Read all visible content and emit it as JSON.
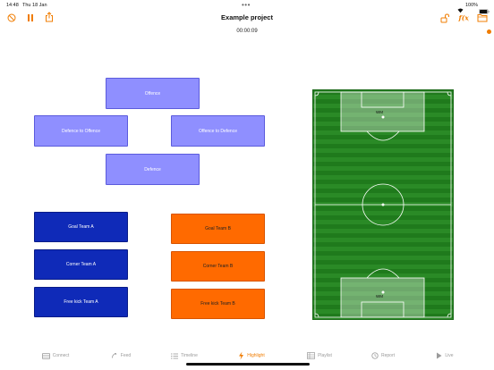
{
  "status_bar": {
    "time": "14:48",
    "date": "Thu 18 Jan",
    "battery": "100%",
    "dots": "•••"
  },
  "toolbar": {
    "title": "Example project",
    "timer": "00:00:09",
    "accent_color": "#f07c00",
    "left_icons": [
      "cancel-icon",
      "pause-icon",
      "share-icon"
    ],
    "right_icons": [
      "unlock-icon",
      "formula-icon",
      "folder-icon"
    ]
  },
  "tags": {
    "purple": [
      {
        "label": "Offence"
      },
      {
        "label": "Defence to Offence"
      },
      {
        "label": "Offence to Defence"
      },
      {
        "label": "Defence"
      }
    ],
    "team_a": [
      {
        "label": "Goal Team A"
      },
      {
        "label": "Corner Team A"
      },
      {
        "label": "Free kick Team A"
      }
    ],
    "team_b": [
      {
        "label": "Goal Team B"
      },
      {
        "label": "Corner Team B"
      },
      {
        "label": "Free kick Team B"
      }
    ],
    "colors": {
      "purple": "#8f8fff",
      "team_a": "#0f2ab8",
      "team_b": "#ff6a00"
    }
  },
  "field": {
    "top_label": "WM",
    "bottom_label": "WM",
    "grass_color": "#2a8a26"
  },
  "tabbar": {
    "items": [
      {
        "label": "Connect",
        "icon": "connect-icon"
      },
      {
        "label": "Feed",
        "icon": "feed-icon"
      },
      {
        "label": "Timeline",
        "icon": "list-icon"
      },
      {
        "label": "Highlight",
        "icon": "bolt-icon",
        "active": true
      },
      {
        "label": "Playlist",
        "icon": "playlist-icon"
      },
      {
        "label": "Report",
        "icon": "report-icon"
      },
      {
        "label": "Live",
        "icon": "play-icon"
      }
    ]
  }
}
